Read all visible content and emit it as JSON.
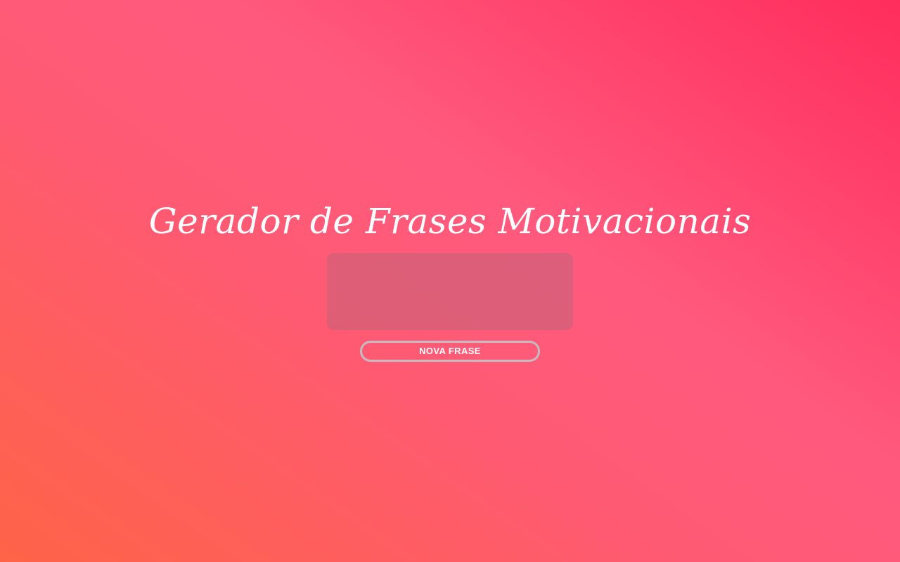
{
  "header": {
    "title": "Gerador de Frases Motivacionais"
  },
  "quote": {
    "text": ""
  },
  "controls": {
    "new_quote_label": "NOVA FRASE"
  },
  "colors": {
    "gradient_start": "#ff6347",
    "gradient_mid": "#ff5a7e",
    "gradient_end": "#ff2d5c",
    "quote_box_bg": "#d9687c",
    "button_border": "#c4bcc0"
  }
}
